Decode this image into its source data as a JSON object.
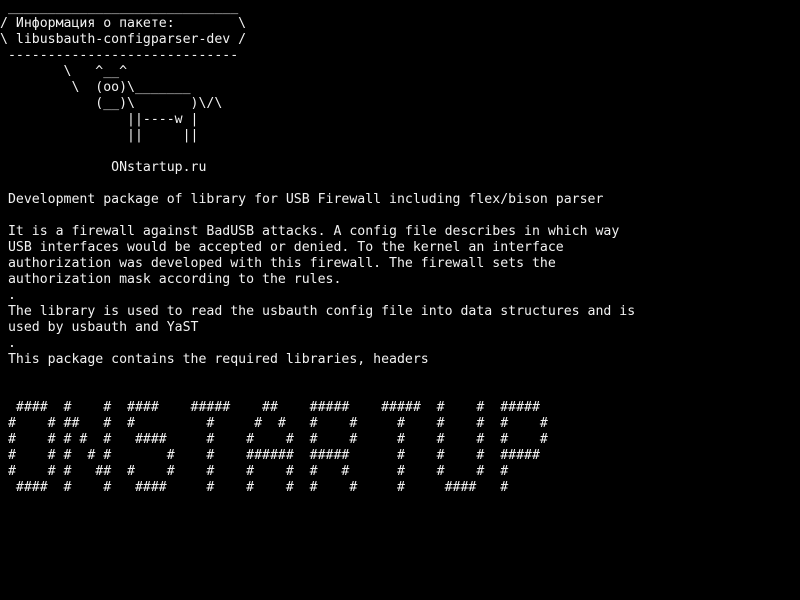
{
  "colors": {
    "background": "#000000",
    "foreground": "#f2f2f2"
  },
  "terminal": {
    "cowsay_lines": [
      " _____________________________",
      "/ Информация о пакете:        \\",
      "\\ libusbauth-configparser-dev /",
      " -----------------------------",
      "        \\   ^__^",
      "         \\  (oo)\\_______",
      "            (__)\\       )\\/\\",
      "                ||----w |",
      "                ||     ||",
      "",
      "              ONstartup.ru"
    ],
    "description_lines": [
      " Development package of library for USB Firewall including flex/bison parser",
      "",
      " It is a firewall against BadUSB attacks. A config file describes in which way",
      " USB interfaces would be accepted or denied. To the kernel an interface",
      " authorization was developed with this firewall. The firewall sets the",
      " authorization mask according to the rules.",
      " .",
      " The library is used to read the usbauth config file into data structures and is",
      " used by usbauth and YaST",
      " .",
      " This package contains the required libraries, headers"
    ],
    "banner_lines": [
      "  ####  #    #  ####    #####    ##    #####    #####  #    #  #####",
      " #    # ##   #  #         #     #  #   #    #     #    #    #  #    #",
      " #    # # #  #   ####     #    #    #  #    #     #    #    #  #    #",
      " #    # #  # #       #    #    ######  #####      #    #    #  #####",
      " #    # #   ##  #    #    #    #    #  #   #      #    #    #  #",
      "  ####  #    #   ####     #    #    #  #    #     #     ####   #"
    ]
  }
}
